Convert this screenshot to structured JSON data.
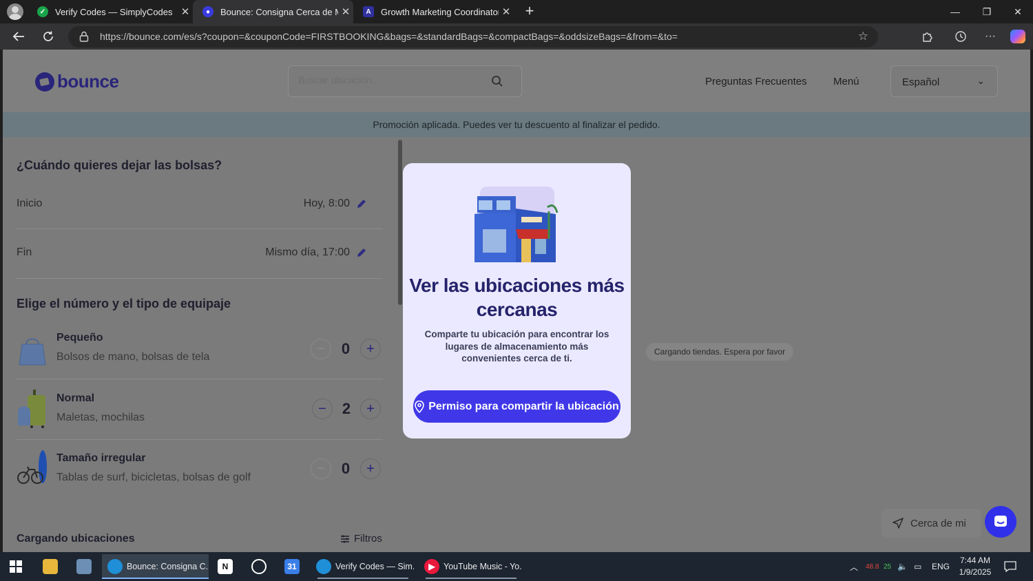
{
  "browser": {
    "tabs": [
      {
        "title": "Verify Codes — SimplyCodes",
        "active": false
      },
      {
        "title": "Bounce: Consigna Cerca de Mí - Guardar equipaje",
        "active": true
      },
      {
        "title": "Growth Marketing Coordinator (Social) - Bounce",
        "active": false
      }
    ],
    "url": "https://bounce.com/es/s?coupon=&couponCode=FIRSTBOOKING&bags=&standardBags=&compactBags=&oddsizeBags=&from=&to="
  },
  "site": {
    "logo_text": "bounce",
    "search_placeholder": "Buscar ubicación...",
    "nav": {
      "faq": "Preguntas Frecuentes",
      "menu": "Menú"
    },
    "language": "Español",
    "promo_banner": "Promoción aplicada. Puedes ver tu descuento al finalizar el pedido."
  },
  "booking": {
    "when_heading": "¿Cuándo quieres dejar las bolsas?",
    "start_label": "Inicio",
    "start_value": "Hoy, 8:00",
    "end_label": "Fin",
    "end_value": "Mismo día, 17:00",
    "bags_heading": "Elige el número y el tipo de equipaje",
    "bags": [
      {
        "title": "Pequeño",
        "subtitle": "Bolsos de mano, bolsas de tela",
        "count": "0"
      },
      {
        "title": "Normal",
        "subtitle": "Maletas, mochilas",
        "count": "2"
      },
      {
        "title": "Tamaño irregular",
        "subtitle": "Tablas de surf, bicicletas, bolsas de golf",
        "count": "0"
      }
    ],
    "locations_heading": "Cargando ubicaciones",
    "filters_label": "Filtros"
  },
  "map": {
    "loading_text": "Cargando tiendas. Espera por favor",
    "near_me_label": "Cerca de mi"
  },
  "modal": {
    "title": "Ver las ubicaciones más cercanas",
    "body": "Comparte tu ubicación para encontrar los lugares de almacenamiento más convenientes cerca de ti.",
    "cta": "Permiso para compartir la ubicación"
  },
  "taskbar": {
    "apps": [
      {
        "label": "Bounce: Consigna C...",
        "active": true
      },
      {
        "label": "Verify Codes — Sim...",
        "active": false
      },
      {
        "label": "YouTube Music - Yo...",
        "active": false
      }
    ],
    "tray": {
      "temp": "48.8",
      "cpu": "25",
      "lang": "ENG"
    },
    "time": "7:44 AM",
    "date": "1/9/2025"
  },
  "colors": {
    "brand_navy": "#25236a",
    "cta_blue": "#4038e8",
    "modal_bg": "#ebe9ff"
  }
}
